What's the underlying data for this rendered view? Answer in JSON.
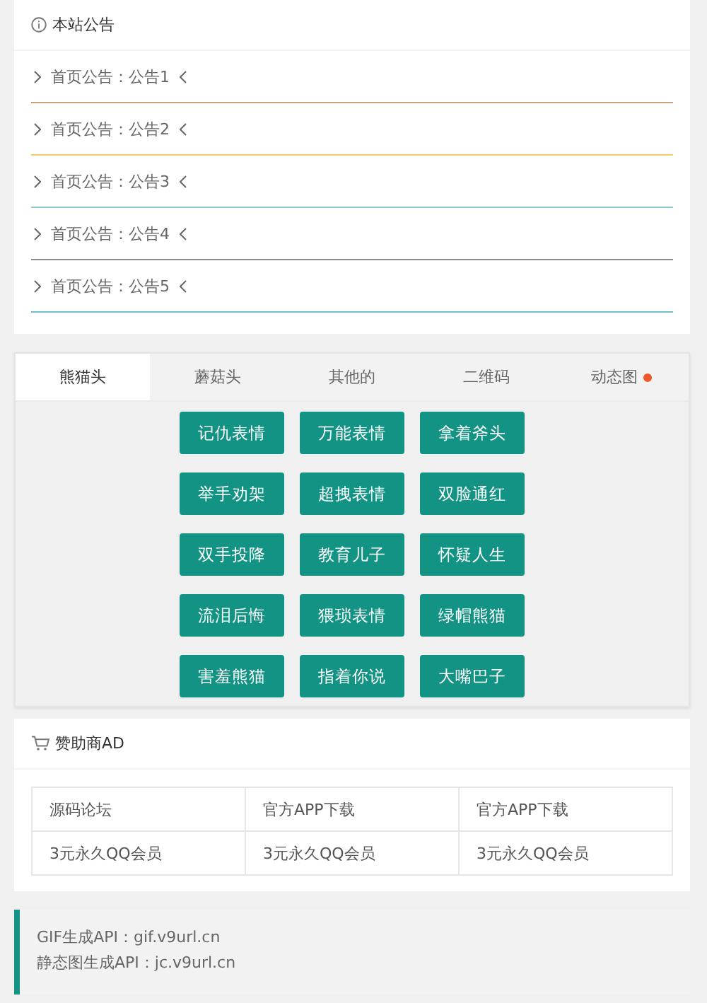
{
  "notice_panel": {
    "title": "本站公告",
    "items": [
      {
        "text": "首页公告：公告1",
        "color": "#c9a27c"
      },
      {
        "text": "首页公告：公告2",
        "color": "#f3cd6a"
      },
      {
        "text": "首页公告：公告3",
        "color": "#8ecbd0"
      },
      {
        "text": "首页公告：公告4",
        "color": "#8c8c8c"
      },
      {
        "text": "首页公告：公告5",
        "color": "#6fc0cf"
      }
    ]
  },
  "emoji_panel": {
    "tabs": [
      {
        "label": "熊猫头",
        "selected": true,
        "dot": false
      },
      {
        "label": "蘑菇头",
        "selected": false,
        "dot": false
      },
      {
        "label": "其他的",
        "selected": false,
        "dot": false
      },
      {
        "label": "二维码",
        "selected": false,
        "dot": false
      },
      {
        "label": "动态图",
        "selected": false,
        "dot": true
      }
    ],
    "buttons": [
      "记仇表情",
      "万能表情",
      "拿着斧头",
      "举手劝架",
      "超拽表情",
      "双脸通红",
      "双手投降",
      "教育儿子",
      "怀疑人生",
      "流泪后悔",
      "猥琐表情",
      "绿帽熊猫",
      "害羞熊猫",
      "指着你说",
      "大嘴巴子"
    ]
  },
  "sponsor_panel": {
    "title": "赞助商AD",
    "rows": [
      [
        "源码论坛",
        "官方APP下载",
        "官方APP下载"
      ],
      [
        "3元永久QQ会员",
        "3元永久QQ会员",
        "3元永久QQ会员"
      ]
    ]
  },
  "api_note": {
    "lines": [
      "GIF生成API：gif.v9url.cn",
      "静态图生成API：jc.v9url.cn"
    ]
  }
}
